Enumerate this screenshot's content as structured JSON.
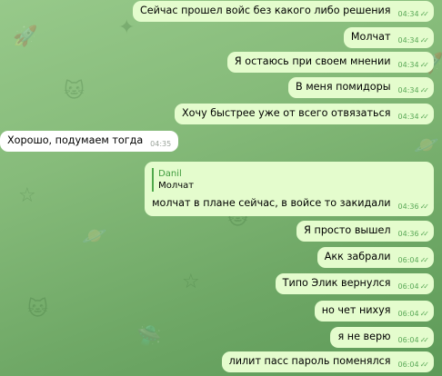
{
  "colors": {
    "outgoing_bubble": "#e4fccd",
    "incoming_bubble": "#ffffff",
    "accent": "#4ea84a"
  },
  "messages": [
    {
      "text": "Сейчас прошел войс без какого либо решения",
      "time": "04:34",
      "dir": "out",
      "status": "read"
    },
    {
      "text": "Молчат",
      "time": "04:34",
      "dir": "out",
      "status": "read"
    },
    {
      "text": "Я остаюсь при своем мнении",
      "time": "04:34",
      "dir": "out",
      "status": "read"
    },
    {
      "text": "В меня помидоры",
      "time": "04:34",
      "dir": "out",
      "status": "read"
    },
    {
      "text": "Хочу быстрее уже от всего отвязаться",
      "time": "04:34",
      "dir": "out",
      "status": "read"
    },
    {
      "text": "Хорошо, подумаем тогда",
      "time": "04:35",
      "dir": "in"
    },
    {
      "text": "молчат в плане сейчас, в войсе то закидали",
      "time": "04:36",
      "dir": "out",
      "status": "read",
      "reply_to": {
        "name": "Danil",
        "text": "Молчат"
      }
    },
    {
      "text": "Я просто вышел",
      "time": "04:36",
      "dir": "out",
      "status": "read"
    },
    {
      "text": "Акк забрали",
      "time": "06:04",
      "dir": "out",
      "status": "read"
    },
    {
      "text": "Типо Элик вернулся",
      "time": "06:04",
      "dir": "out",
      "status": "read"
    },
    {
      "text": "но чет нихуя",
      "time": "06:04",
      "dir": "out",
      "status": "read"
    },
    {
      "text": "я не верю",
      "time": "06:04",
      "dir": "out",
      "status": "read"
    },
    {
      "text": "лилит пасс пароль поменялся",
      "time": "06:04",
      "dir": "out",
      "status": "read"
    }
  ]
}
